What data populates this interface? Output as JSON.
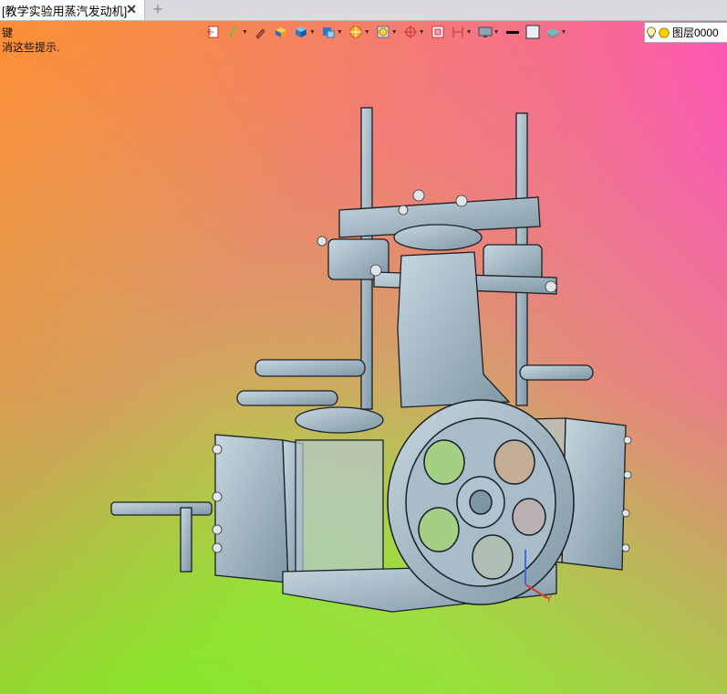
{
  "tab": {
    "title": "[教学实验用蒸汽发动机]",
    "close_glyph": "✕",
    "add_glyph": "+"
  },
  "hints": {
    "line1": "键",
    "line2": "消这些提示."
  },
  "toolbar": {
    "items": [
      "exit-sketch-icon",
      "pen-icon",
      "brush-icon",
      "cube-yellow-icon",
      "cube-blue-icon",
      "view-cube-icon",
      "section-icon",
      "render-icon",
      "line-style-icon",
      "snap-icon",
      "frame-icon",
      "display-icon",
      "color-black",
      "color-white",
      "layer-icon"
    ]
  },
  "layer": {
    "label": "图层0000"
  },
  "axis": {
    "label": "Y"
  },
  "colors": {
    "model": "#9fb4c1",
    "edge": "#1a1f24",
    "accent_orange": "#ff8f30",
    "accent_pink": "#ff4fc2",
    "accent_green": "#7fe81e"
  }
}
